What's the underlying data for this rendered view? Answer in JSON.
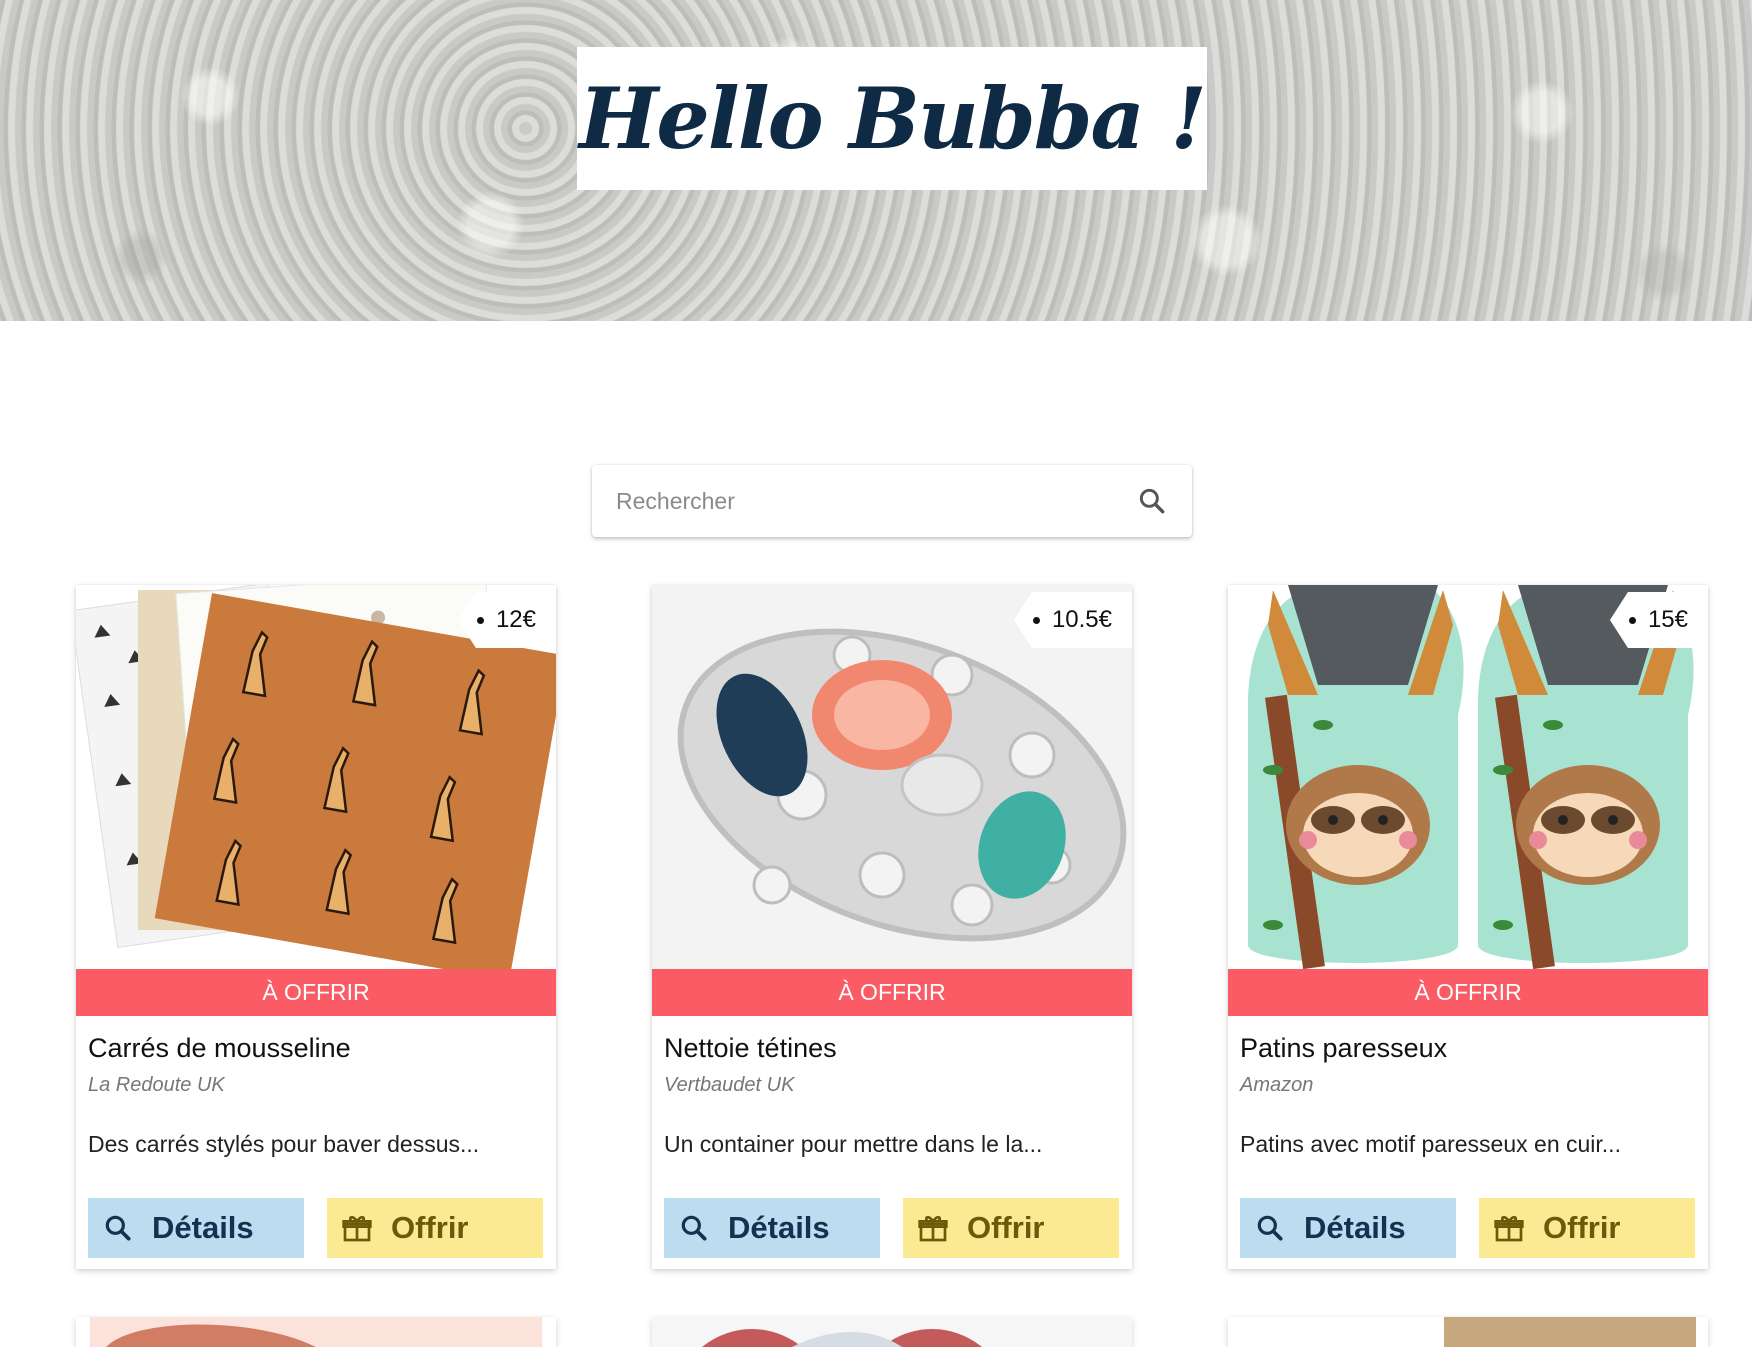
{
  "header": {
    "logo_text": "Hello Bubba !"
  },
  "search": {
    "placeholder": "Rechercher",
    "icon": "search-icon"
  },
  "products": [
    {
      "price": "12€",
      "badge": "À OFFRIR",
      "title": "Carrés de mousseline",
      "vendor": "La Redoute UK",
      "description": "Des carrés stylés pour baver dessus...",
      "details_label": "Détails",
      "offer_label": "Offrir"
    },
    {
      "price": "10.5€",
      "badge": "À OFFRIR",
      "title": "Nettoie tétines",
      "vendor": "Vertbaudet UK",
      "description": "Un container pour mettre dans le la...",
      "details_label": "Détails",
      "offer_label": "Offrir"
    },
    {
      "price": "15€",
      "badge": "À OFFRIR",
      "title": "Patins paresseux",
      "vendor": "Amazon",
      "description": "Patins avec motif paresseux en cuir...",
      "details_label": "Détails",
      "offer_label": "Offrir"
    }
  ],
  "colors": {
    "badge": "#fb5b64",
    "details_button": "#bcdcf0",
    "offer_button": "#fbea92",
    "logo_text": "#0f2a44"
  }
}
